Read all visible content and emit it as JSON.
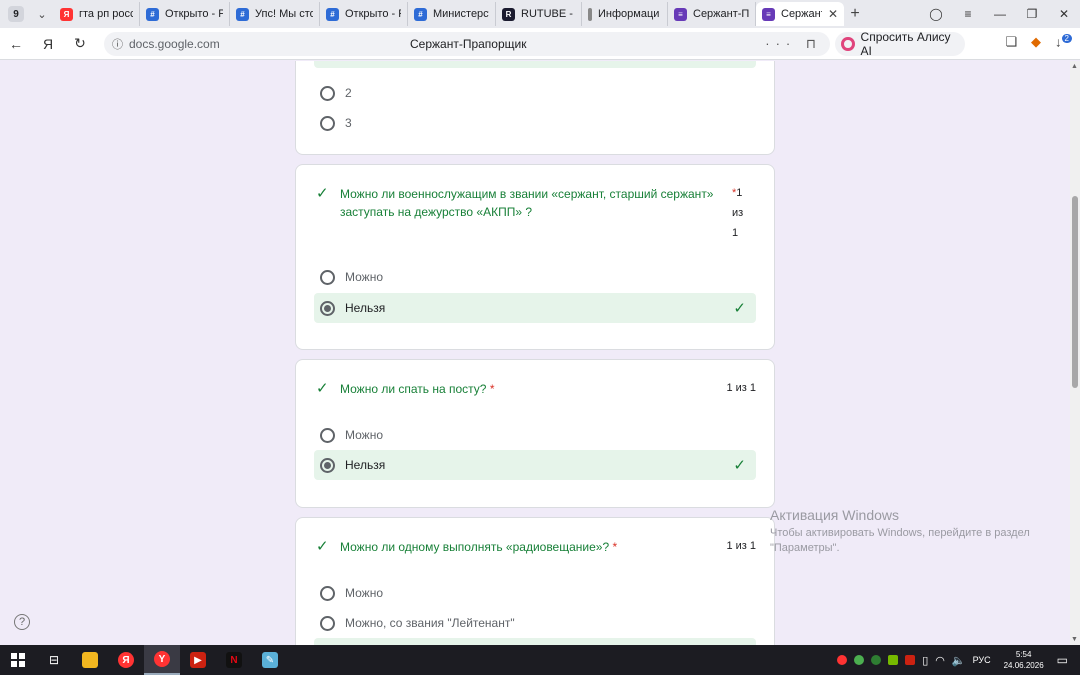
{
  "tabstrip": {
    "count": "9",
    "tabs": [
      {
        "title": "гта рп росси",
        "color": "#f33"
      },
      {
        "title": "Открыто - Р",
        "color": "#2e6bd6"
      },
      {
        "title": "Упс! Мы сто",
        "color": "#2e6bd6"
      },
      {
        "title": "Открыто - Р",
        "color": "#2e6bd6"
      },
      {
        "title": "Министерст",
        "color": "#2e6bd6"
      },
      {
        "title": "RUTUBE - сп",
        "color": "#1b1b2f"
      },
      {
        "title": "Информаци",
        "color": "#888"
      },
      {
        "title": "Сержант-Пр",
        "color": "#673ab7"
      },
      {
        "title": "Сержант",
        "color": "#673ab7"
      }
    ]
  },
  "toolbar": {
    "url": "docs.google.com",
    "page_title": "Сержант-Прапорщик",
    "alice_label": "Спросить Алису AI",
    "downloads_badge": "2"
  },
  "cards": {
    "c0": {
      "opts": [
        "2",
        "3"
      ]
    },
    "c1": {
      "question": "Можно ли военнослужащим в звании «сержант, старший сержант» заступать на дежурство «АКПП» ?",
      "score_top": "1",
      "score_mid": "из",
      "score_bot": "1",
      "opts": [
        "Можно",
        "Нельзя"
      ]
    },
    "c2": {
      "question": "Можно ли спать на посту?",
      "score": "1 из 1",
      "opts": [
        "Можно",
        "Нельзя"
      ]
    },
    "c3": {
      "question": "Можно ли одному выполнять «радиовещание»?",
      "score": "1 из 1",
      "opts": [
        "Можно",
        "Можно, со звания \"Лейтенант\""
      ]
    }
  },
  "activation": {
    "title": "Активация Windows",
    "sub": "Чтобы активировать Windows, перейдите в раздел \"Параметры\"."
  },
  "taskbar": {
    "lang": "РУС",
    "time": "5:54",
    "date": "24.06.2026"
  }
}
